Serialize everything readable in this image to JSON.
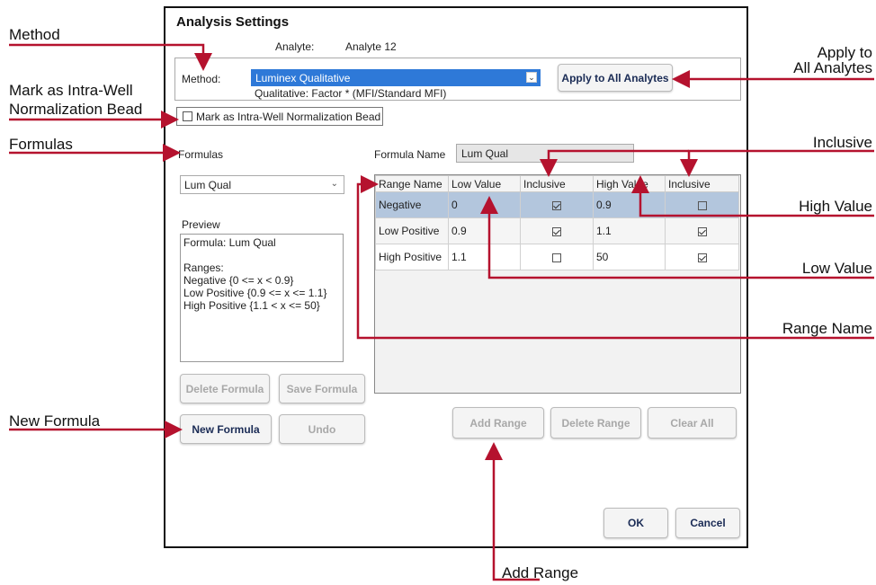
{
  "callouts": {
    "method": "Method",
    "intra_well_line1": "Mark as Intra-Well",
    "intra_well_line2": "Normalization Bead",
    "formulas": "Formulas",
    "new_formula": "New Formula",
    "apply_line1": "Apply to",
    "apply_line2": "All Analytes",
    "inclusive": "Inclusive",
    "high_value": "High Value",
    "low_value": "Low Value",
    "range_name": "Range Name",
    "add_range": "Add Range"
  },
  "dialog": {
    "title": "Analysis Settings",
    "analyte_label": "Analyte:",
    "analyte_value": "Analyte 12",
    "method_label": "Method:",
    "method_value": "Luminex Qualitative",
    "method_desc": "Qualitative: Factor * (MFI/Standard MFI)",
    "apply_all_button": "Apply to All Analytes",
    "intra_well_checkbox": "Mark as Intra-Well Normalization Bead",
    "formulas_label": "Formulas",
    "formula_select": "Lum Qual",
    "formula_name_label": "Formula Name",
    "formula_name_value": "Lum Qual",
    "preview_label": "Preview",
    "preview_lines": [
      "Formula: Lum Qual",
      "",
      "Ranges:",
      "Negative {0 <=  x  < 0.9}",
      "Low Positive {0.9 <=  x  <= 1.1}",
      "High Positive {1.1 <  x  <= 50}"
    ],
    "buttons": {
      "delete_formula": "Delete Formula",
      "save_formula": "Save Formula",
      "new_formula": "New Formula",
      "undo": "Undo",
      "add_range": "Add Range",
      "delete_range": "Delete Range",
      "clear_all": "Clear All",
      "ok": "OK",
      "cancel": "Cancel"
    },
    "table": {
      "headers": [
        "Range Name",
        "Low Value",
        "Inclusive",
        "High Value",
        "Inclusive"
      ],
      "rows": [
        {
          "name": "Negative",
          "low": "0",
          "low_inclusive": true,
          "high": "0.9",
          "high_inclusive": false
        },
        {
          "name": "Low Positive",
          "low": "0.9",
          "low_inclusive": true,
          "high": "1.1",
          "high_inclusive": true
        },
        {
          "name": "High Positive",
          "low": "1.1",
          "low_inclusive": false,
          "high": "50",
          "high_inclusive": true
        }
      ]
    }
  },
  "colors": {
    "annotation_arrow": "#b5122e",
    "selection_blue": "#2e79d8",
    "selected_row": "#b3c6dd"
  }
}
